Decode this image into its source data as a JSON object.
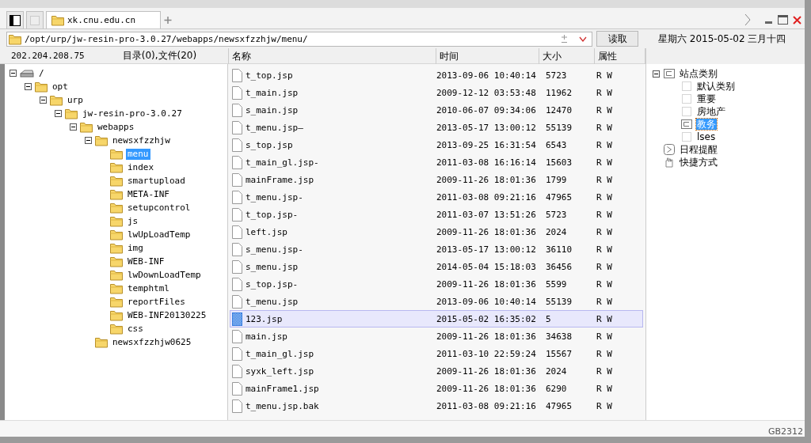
{
  "tabs": [
    {
      "label": "xk.cnu.edu.cn",
      "selected": true
    }
  ],
  "address": {
    "value": "/opt/urp/jw-resin-pro-3.0.27/webapps/newsxfzzhjw/menu/",
    "button": "读取"
  },
  "date_label": "星期六 2015-05-02 三月十四",
  "left_header": {
    "host": "202.204.208.75",
    "summary": "目录(0),文件(20)"
  },
  "folder_tree": [
    {
      "name": "/",
      "kind": "drive",
      "expanded": true,
      "selected": false,
      "children": [
        {
          "name": "opt",
          "kind": "folder",
          "expanded": true,
          "selected": false,
          "children": [
            {
              "name": "urp",
              "kind": "folder",
              "expanded": true,
              "selected": false,
              "children": [
                {
                  "name": "jw-resin-pro-3.0.27",
                  "kind": "folder",
                  "expanded": true,
                  "selected": false,
                  "children": [
                    {
                      "name": "webapps",
                      "kind": "folder",
                      "expanded": true,
                      "selected": false,
                      "children": [
                        {
                          "name": "newsxfzzhjw",
                          "kind": "folder",
                          "expanded": true,
                          "selected": false,
                          "children": [
                            {
                              "name": "menu",
                              "kind": "folder",
                              "selected": true
                            },
                            {
                              "name": "index",
                              "kind": "folder",
                              "selected": false
                            },
                            {
                              "name": "smartupload",
                              "kind": "folder",
                              "selected": false
                            },
                            {
                              "name": "META-INF",
                              "kind": "folder",
                              "selected": false
                            },
                            {
                              "name": "setupcontrol",
                              "kind": "folder",
                              "selected": false
                            },
                            {
                              "name": "js",
                              "kind": "folder",
                              "selected": false
                            },
                            {
                              "name": "lwUpLoadTemp",
                              "kind": "folder",
                              "selected": false
                            },
                            {
                              "name": "img",
                              "kind": "folder",
                              "selected": false
                            },
                            {
                              "name": "WEB-INF",
                              "kind": "folder",
                              "selected": false
                            },
                            {
                              "name": "lwDownLoadTemp",
                              "kind": "folder",
                              "selected": false
                            },
                            {
                              "name": "temphtml",
                              "kind": "folder",
                              "selected": false
                            },
                            {
                              "name": "reportFiles",
                              "kind": "folder",
                              "selected": false
                            },
                            {
                              "name": "WEB-INF20130225",
                              "kind": "folder",
                              "selected": false
                            },
                            {
                              "name": "css",
                              "kind": "folder",
                              "selected": false
                            }
                          ]
                        },
                        {
                          "name": "newsxfzzhjw0625",
                          "kind": "folder",
                          "selected": false
                        }
                      ]
                    }
                  ]
                }
              ]
            }
          ]
        }
      ]
    }
  ],
  "file_table": {
    "columns": [
      "名称",
      "时间",
      "大小",
      "属性"
    ],
    "rows": [
      {
        "name": "t_top.jsp",
        "time": "2013-09-06 10:40:14",
        "size": "5723",
        "attr": "R W",
        "selected": false
      },
      {
        "name": "t_main.jsp",
        "time": "2009-12-12 03:53:48",
        "size": "11962",
        "attr": "R W",
        "selected": false
      },
      {
        "name": "s_main.jsp",
        "time": "2010-06-07 09:34:06",
        "size": "12470",
        "attr": "R W",
        "selected": false
      },
      {
        "name": "t_menu.jsp—",
        "time": "2013-05-17 13:00:12",
        "size": "55139",
        "attr": "R W",
        "selected": false
      },
      {
        "name": "s_top.jsp",
        "time": "2013-09-25 16:31:54",
        "size": "6543",
        "attr": "R W",
        "selected": false
      },
      {
        "name": "t_main_gl.jsp-",
        "time": "2011-03-08 16:16:14",
        "size": "15603",
        "attr": "R W",
        "selected": false
      },
      {
        "name": "mainFrame.jsp",
        "time": "2009-11-26 18:01:36",
        "size": "1799",
        "attr": "R W",
        "selected": false
      },
      {
        "name": "t_menu.jsp-",
        "time": "2011-03-08 09:21:16",
        "size": "47965",
        "attr": "R W",
        "selected": false
      },
      {
        "name": "t_top.jsp-",
        "time": "2011-03-07 13:51:26",
        "size": "5723",
        "attr": "R W",
        "selected": false
      },
      {
        "name": "left.jsp",
        "time": "2009-11-26 18:01:36",
        "size": "2024",
        "attr": "R W",
        "selected": false
      },
      {
        "name": "s_menu.jsp-",
        "time": "2013-05-17 13:00:12",
        "size": "36110",
        "attr": "R W",
        "selected": false
      },
      {
        "name": "s_menu.jsp",
        "time": "2014-05-04 15:18:03",
        "size": "36456",
        "attr": "R W",
        "selected": false
      },
      {
        "name": "s_top.jsp-",
        "time": "2009-11-26 18:01:36",
        "size": "5599",
        "attr": "R W",
        "selected": false
      },
      {
        "name": "t_menu.jsp",
        "time": "2013-09-06 10:40:14",
        "size": "55139",
        "attr": "R W",
        "selected": false
      },
      {
        "name": "123.jsp",
        "time": "2015-05-02 16:35:02",
        "size": "5",
        "attr": "R W",
        "selected": true
      },
      {
        "name": "main.jsp",
        "time": "2009-11-26 18:01:36",
        "size": "34638",
        "attr": "R W",
        "selected": false
      },
      {
        "name": "t_main_gl.jsp",
        "time": "2011-03-10 22:59:24",
        "size": "15567",
        "attr": "R W",
        "selected": false
      },
      {
        "name": "syxk_left.jsp",
        "time": "2009-11-26 18:01:36",
        "size": "2024",
        "attr": "R W",
        "selected": false
      },
      {
        "name": "mainFrame1.jsp",
        "time": "2009-11-26 18:01:36",
        "size": "6290",
        "attr": "R W",
        "selected": false
      },
      {
        "name": "t_menu.jsp.bak",
        "time": "2011-03-08 09:21:16",
        "size": "47965",
        "attr": "R W",
        "selected": false
      }
    ]
  },
  "side_tree": [
    {
      "label": "站点类别",
      "kind": "category",
      "expanded": true,
      "children": [
        {
          "label": "默认类别",
          "selected": false
        },
        {
          "label": "重要",
          "selected": false
        },
        {
          "label": "房地产",
          "selected": false
        },
        {
          "label": "教务",
          "selected": true
        },
        {
          "label": "lses",
          "selected": false
        }
      ]
    },
    {
      "label": "日程提醒",
      "kind": "schedule"
    },
    {
      "label": "快捷方式",
      "kind": "shortcut"
    }
  ],
  "status": "GB2312"
}
